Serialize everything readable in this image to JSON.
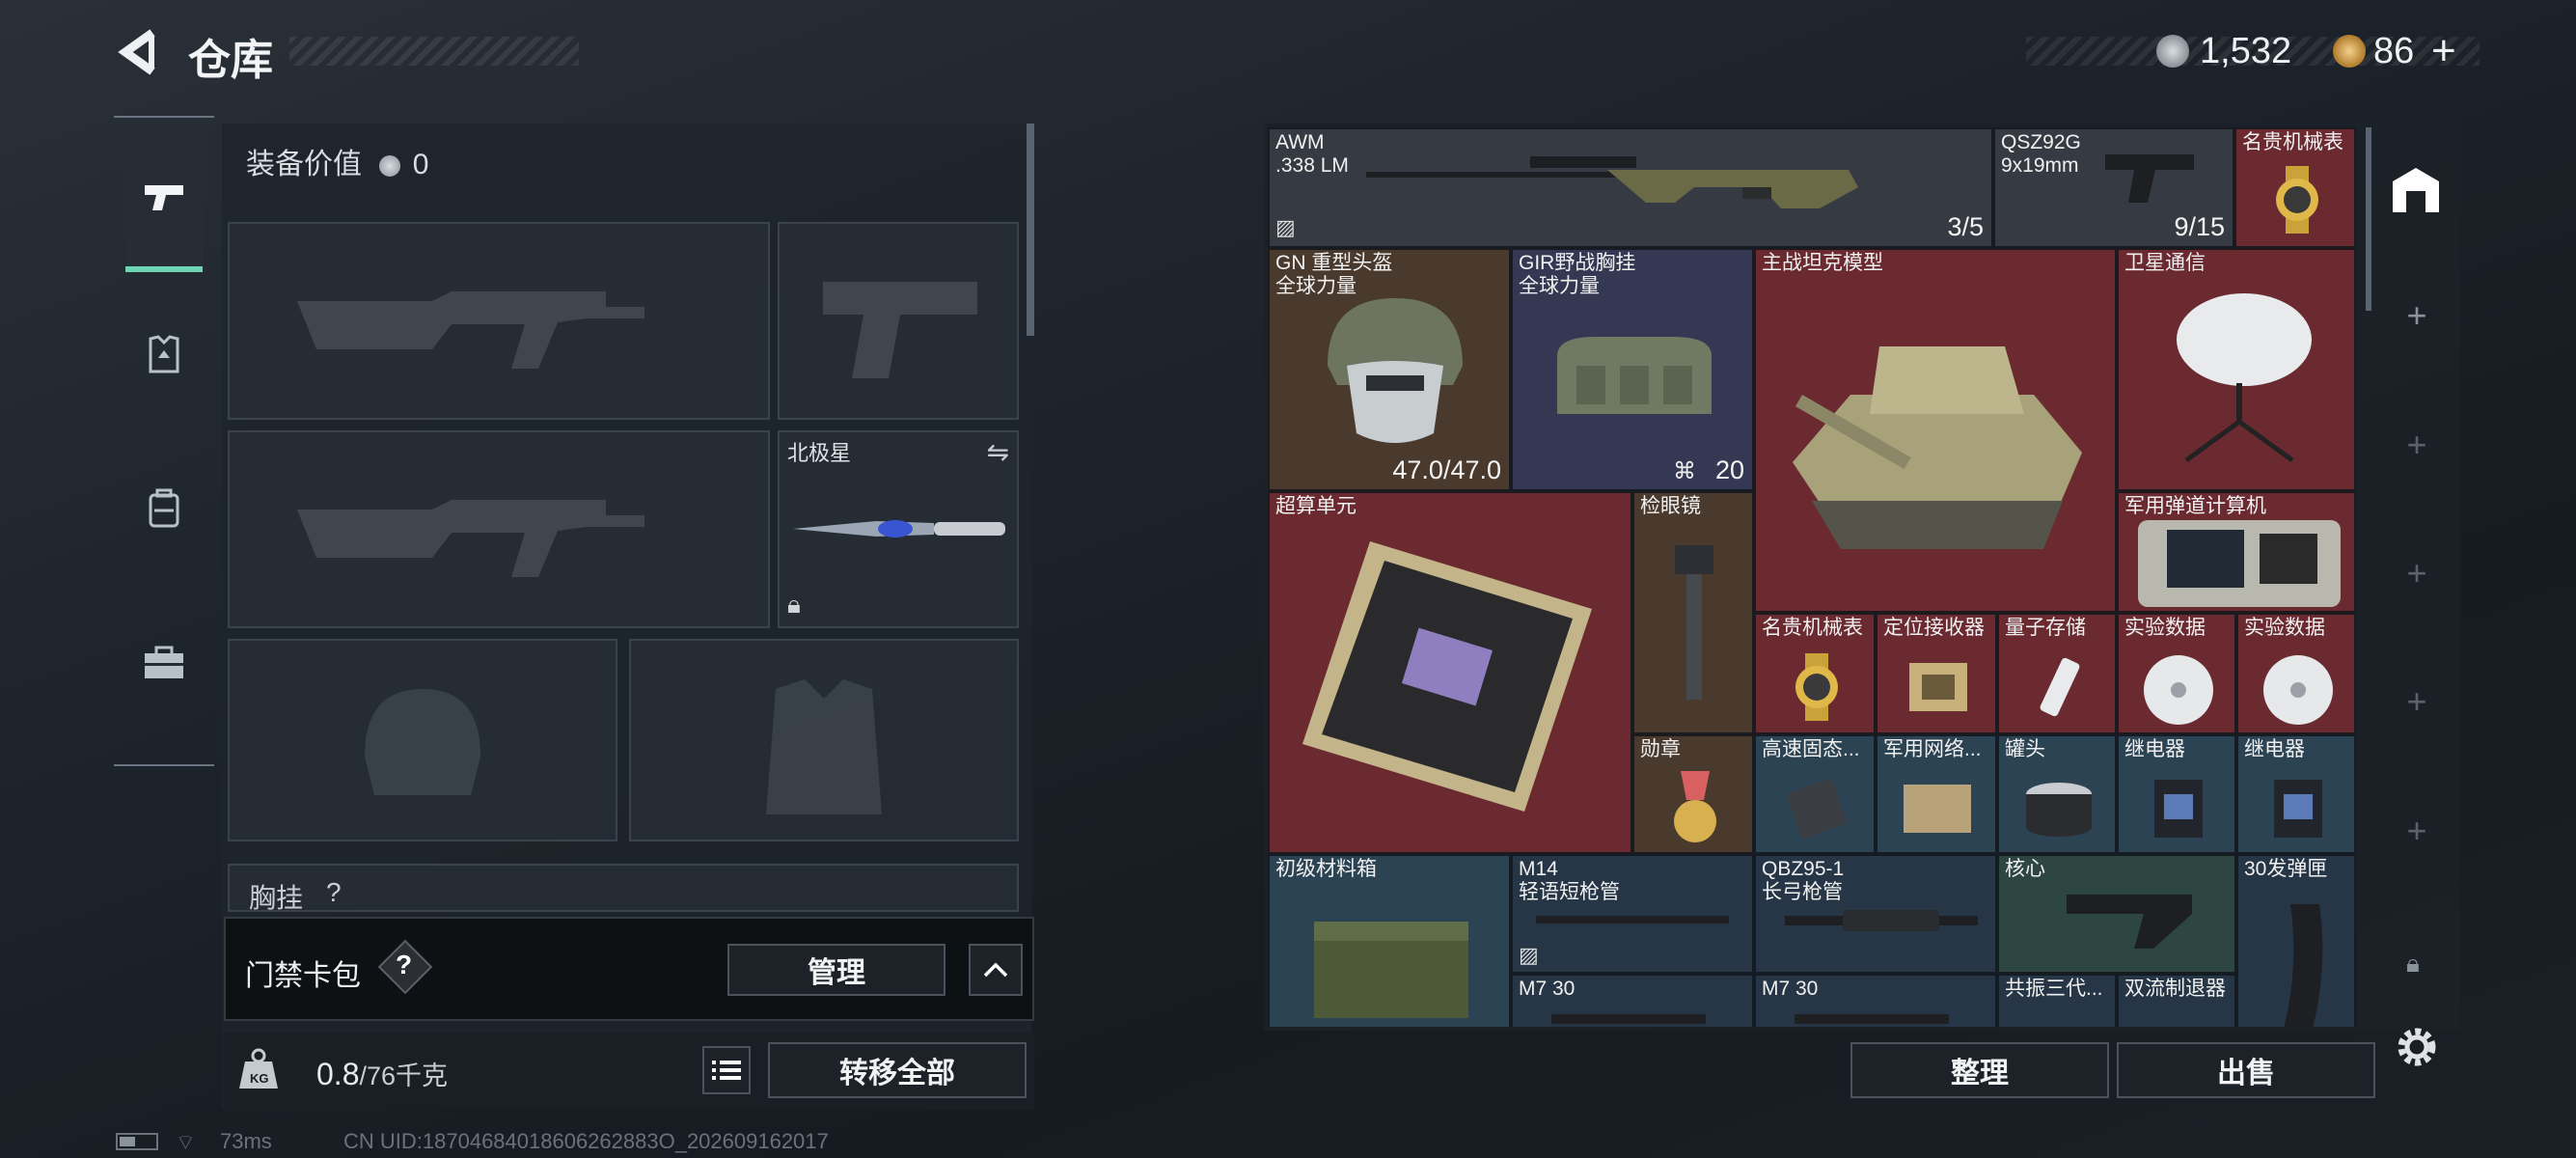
{
  "header": {
    "title": "仓库",
    "currency1": "1,532",
    "currency2": "86",
    "add_symbol": "+",
    "back_icon": "back-arrow-icon"
  },
  "left_tabs": [
    {
      "name": "weapons",
      "icon": "pistol-icon",
      "active": true
    },
    {
      "name": "armor",
      "icon": "vest-badge-icon",
      "active": false
    },
    {
      "name": "backpack",
      "icon": "backpack-icon",
      "active": false
    },
    {
      "name": "case",
      "icon": "toolbox-icon",
      "active": false
    }
  ],
  "loadout": {
    "equipment_value_label": "装备价值",
    "equipment_value": "0",
    "melee_name": "北极星",
    "chest_label": "胸挂",
    "chest_suffix": "?"
  },
  "keycard": {
    "label": "门禁卡包",
    "help": "?",
    "manage": "管理"
  },
  "weight": {
    "current": "0.8",
    "max": "/76千克",
    "transfer_all": "转移全部"
  },
  "items": [
    {
      "id": "awm",
      "name": "AWM\n.338 LM",
      "count": "3/5",
      "color": "gray"
    },
    {
      "id": "qsz",
      "name": "QSZ92G\n9x19mm",
      "count": "9/15",
      "color": "gray"
    },
    {
      "id": "watch1",
      "name": "名贵机械表",
      "count": "",
      "color": "red"
    },
    {
      "id": "helmet",
      "name": "GN 重型头盔\n全球力量",
      "count": "47.0/47.0",
      "color": "brown"
    },
    {
      "id": "rig",
      "name": "GIR野战胸挂\n全球力量",
      "count": "20",
      "color": "navy"
    },
    {
      "id": "tank",
      "name": "主战坦克模型",
      "count": "",
      "color": "red"
    },
    {
      "id": "sat",
      "name": "卫星通信",
      "count": "",
      "color": "red"
    },
    {
      "id": "calc",
      "name": "军用弹道计算机",
      "count": "",
      "color": "red"
    },
    {
      "id": "super",
      "name": "超算单元",
      "count": "",
      "color": "red"
    },
    {
      "id": "scope",
      "name": "检眼镜",
      "count": "",
      "color": "brown"
    },
    {
      "id": "watch2",
      "name": "名贵机械表",
      "count": "",
      "color": "red"
    },
    {
      "id": "gps",
      "name": "定位接收器",
      "count": "",
      "color": "red"
    },
    {
      "id": "quantum",
      "name": "量子存储",
      "count": "",
      "color": "red"
    },
    {
      "id": "exp1",
      "name": "实验数据",
      "count": "",
      "color": "red"
    },
    {
      "id": "exp2",
      "name": "实验数据",
      "count": "",
      "color": "red"
    },
    {
      "id": "medal",
      "name": "勋章",
      "count": "",
      "color": "brown"
    },
    {
      "id": "ssd",
      "name": "高速固态...",
      "count": "",
      "color": "blue"
    },
    {
      "id": "net",
      "name": "军用网络...",
      "count": "",
      "color": "blue"
    },
    {
      "id": "can",
      "name": "罐头",
      "count": "",
      "color": "blue"
    },
    {
      "id": "relay1",
      "name": "继电器",
      "count": "",
      "color": "blue"
    },
    {
      "id": "relay2",
      "name": "继电器",
      "count": "",
      "color": "blue"
    },
    {
      "id": "box",
      "name": "初级材料箱",
      "count": "",
      "color": "blue"
    },
    {
      "id": "m14",
      "name": "M14\n轻语短枪管",
      "count": "",
      "color": "dblue"
    },
    {
      "id": "qbz",
      "name": "QBZ95-1\n长弓枪管",
      "count": "",
      "color": "dblue"
    },
    {
      "id": "core",
      "name": "核心",
      "count": "",
      "color": "green"
    },
    {
      "id": "mag30",
      "name": "30发弹匣",
      "count": "",
      "color": "dblue"
    },
    {
      "id": "m7a",
      "name": "M7 30",
      "count": "",
      "color": "dblue"
    },
    {
      "id": "m7b",
      "name": "M7 30",
      "count": "",
      "color": "dblue"
    },
    {
      "id": "reso",
      "name": "共振三代...",
      "count": "",
      "color": "dblue"
    },
    {
      "id": "muzzle",
      "name": "双流制退器",
      "count": "",
      "color": "dblue"
    }
  ],
  "actions": {
    "sort": "整理",
    "sell": "出售"
  },
  "status": {
    "ping": "73ms",
    "uid": "CN UID:18704684018606262883O_202609162017"
  }
}
